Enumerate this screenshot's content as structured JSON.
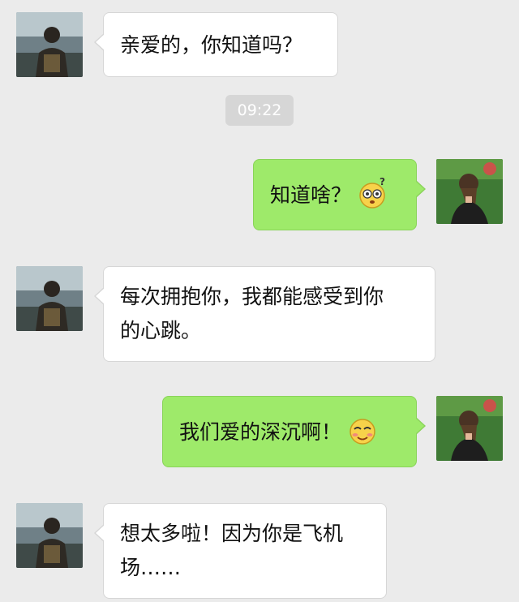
{
  "chat": {
    "timestamp": "09:22",
    "messages": [
      {
        "sender": "contact",
        "text": "亲爱的，你知道吗？"
      },
      {
        "sender": "me",
        "text": "知道啥？",
        "emoji": "dizzy-confused-face-emoji"
      },
      {
        "sender": "contact",
        "line1": "每次拥抱你，我都能感受到你",
        "line2": "的心跳。"
      },
      {
        "sender": "me",
        "text": "我们爱的深沉啊！",
        "emoji": "blushing-smile-face-emoji"
      },
      {
        "sender": "contact",
        "line1": "想太多啦！因为你是飞机",
        "line2": "场……"
      }
    ]
  },
  "colors": {
    "background": "#ebebeb",
    "incoming_bubble": "#ffffff",
    "outgoing_bubble": "#9eea6a",
    "timestamp_bg": "#d6d6d6"
  }
}
